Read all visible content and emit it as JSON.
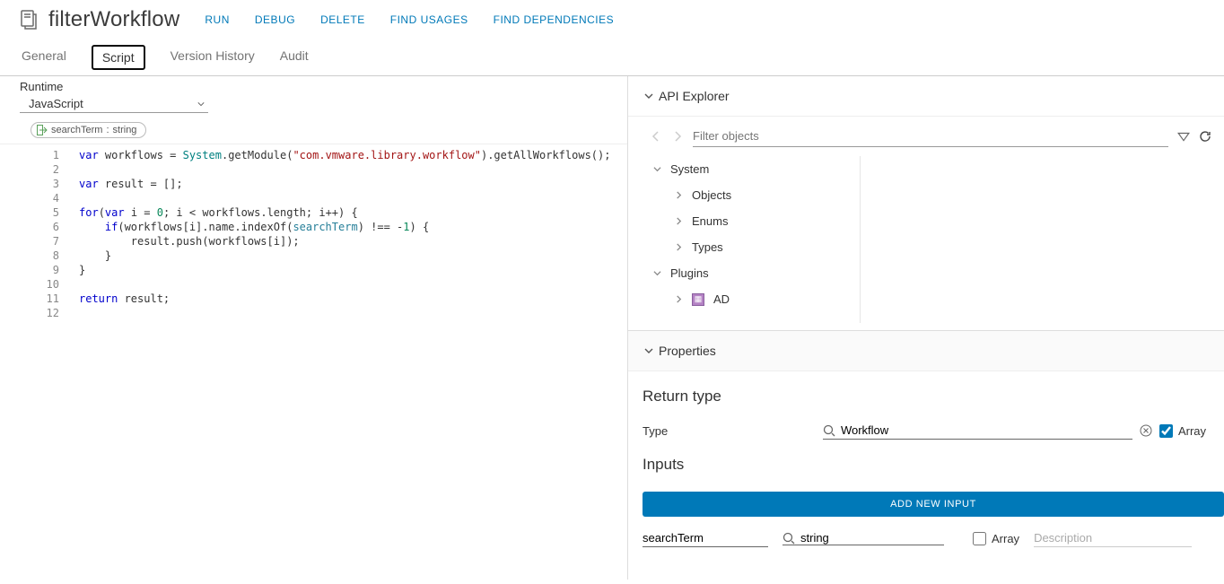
{
  "header": {
    "title": "filterWorkflow",
    "actions": [
      "RUN",
      "DEBUG",
      "DELETE",
      "FIND USAGES",
      "FIND DEPENDENCIES"
    ]
  },
  "tabs": [
    "General",
    "Script",
    "Version History",
    "Audit"
  ],
  "active_tab": "Script",
  "runtime": {
    "label": "Runtime",
    "value": "JavaScript"
  },
  "param_chip": {
    "name": "searchTerm",
    "type": "string"
  },
  "code": {
    "lines": [
      1,
      2,
      3,
      4,
      5,
      6,
      7,
      8,
      9,
      10,
      11,
      12
    ],
    "l1_var": "var",
    "l1_ws": " workflows = ",
    "l1_sys": "System",
    "l1_gm": ".getModule(",
    "l1_str": "\"com.vmware.library.workflow\"",
    "l1_tail": ").getAllWorkflows();",
    "l3_var": "var",
    "l3_rest": " result = [];",
    "l5_for": "for",
    "l5_p1": "(",
    "l5_var": "var",
    "l5_p2": " i = ",
    "l5_zero": "0",
    "l5_p3": "; i < workflows.length; i++) {",
    "l6_indent": "    ",
    "l6_if": "if",
    "l6_p1": "(workflows[i].name.indexOf(",
    "l6_st": "searchTerm",
    "l6_p2": ") !== -",
    "l6_one": "1",
    "l6_p3": ") {",
    "l7": "        result.push(workflows[i]);",
    "l8": "    }",
    "l9": "}",
    "l11_ret": "return",
    "l11_rest": " result;"
  },
  "api": {
    "title": "API Explorer",
    "filter_placeholder": "Filter objects",
    "tree": {
      "system": "System",
      "objects": "Objects",
      "enums": "Enums",
      "types": "Types",
      "plugins": "Plugins",
      "ad": "AD"
    }
  },
  "properties": {
    "title": "Properties",
    "return_section": "Return type",
    "type_label": "Type",
    "type_value": "Workflow",
    "array_label": "Array",
    "array_checked": true,
    "inputs_section": "Inputs",
    "add_btn": "ADD NEW INPUT",
    "input_row": {
      "name": "searchTerm",
      "type": "string",
      "array_label": "Array",
      "array_checked": false,
      "desc_placeholder": "Description"
    }
  }
}
